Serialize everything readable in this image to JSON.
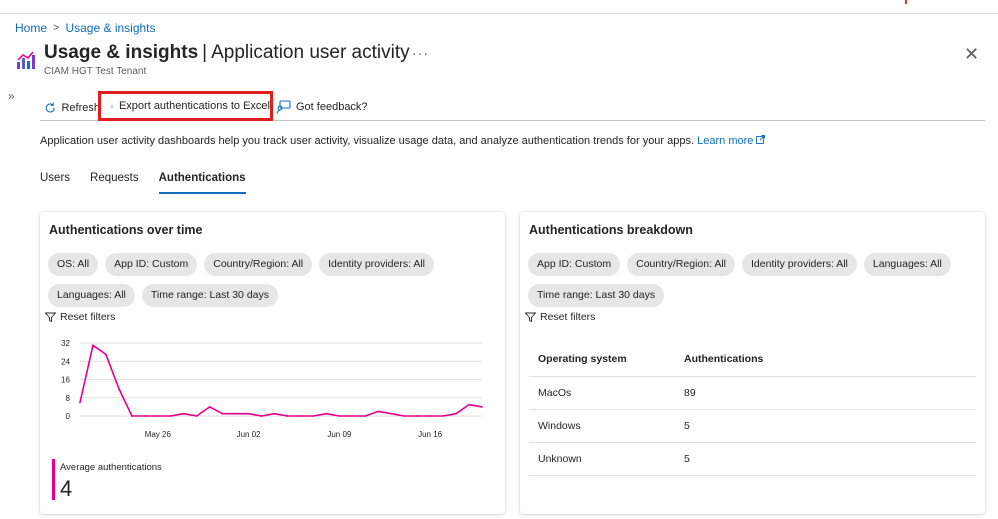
{
  "breadcrumb": {
    "home": "Home",
    "separator": ">",
    "current": "Usage & insights"
  },
  "header": {
    "title_main": "Usage & insights",
    "title_pipe": "|",
    "title_sub": "Application user activity",
    "subtitle": "CIAM HGT Test Tenant",
    "more": "···",
    "close": "✕",
    "icon": "chart-bars-icon"
  },
  "sidebar": {
    "expander": "»"
  },
  "toolbar": {
    "refresh_label": "Refresh",
    "export_label": "Export authentications to Excel",
    "feedback_label": "Got feedback?",
    "highlight_color": "#e01e1e"
  },
  "description": {
    "text": "Application user activity dashboards help you track user activity, visualize usage data, and analyze authentication trends for your apps.",
    "link": "Learn more"
  },
  "tabs": [
    {
      "label": "Users",
      "active": false
    },
    {
      "label": "Requests",
      "active": false
    },
    {
      "label": "Authentications",
      "active": true
    }
  ],
  "left_card": {
    "title": "Authentications over time",
    "filters": [
      "OS: All",
      "App ID: Custom",
      "Country/Region: All",
      "Identity providers: All",
      "Languages: All",
      "Time range: Last 30 days"
    ],
    "reset_label": "Reset filters",
    "avg_label": "Average authentications",
    "avg_value": "4"
  },
  "right_card": {
    "title": "Authentications breakdown",
    "filters": [
      "App ID: Custom",
      "Country/Region: All",
      "Identity providers: All",
      "Languages: All",
      "Time range: Last 30 days"
    ],
    "reset_label": "Reset filters",
    "columns": [
      "Operating system",
      "Authentications"
    ],
    "rows": [
      {
        "os": "MacOs",
        "count": "89"
      },
      {
        "os": "Windows",
        "count": "5"
      },
      {
        "os": "Unknown",
        "count": "5"
      }
    ]
  },
  "colors": {
    "accent": "#0f6cbd",
    "series": "#e3008c"
  },
  "chart_data": {
    "type": "line",
    "y_ticks": [
      "32",
      "24",
      "16",
      "8",
      "0"
    ],
    "ylim": [
      0,
      32
    ],
    "x_tick_labels": [
      "May 26",
      "Jun 02",
      "Jun 09",
      "Jun 16"
    ],
    "x_tick_index": [
      6,
      13,
      20,
      27
    ],
    "values": [
      6,
      31,
      27,
      12,
      0,
      0,
      0,
      0,
      1,
      0,
      4,
      1,
      1,
      1,
      0,
      1,
      0,
      0,
      0,
      1,
      0,
      0,
      0,
      2,
      1,
      0,
      0,
      0,
      0,
      1,
      5,
      4
    ],
    "grid": true,
    "series_color": "#e3008c"
  }
}
